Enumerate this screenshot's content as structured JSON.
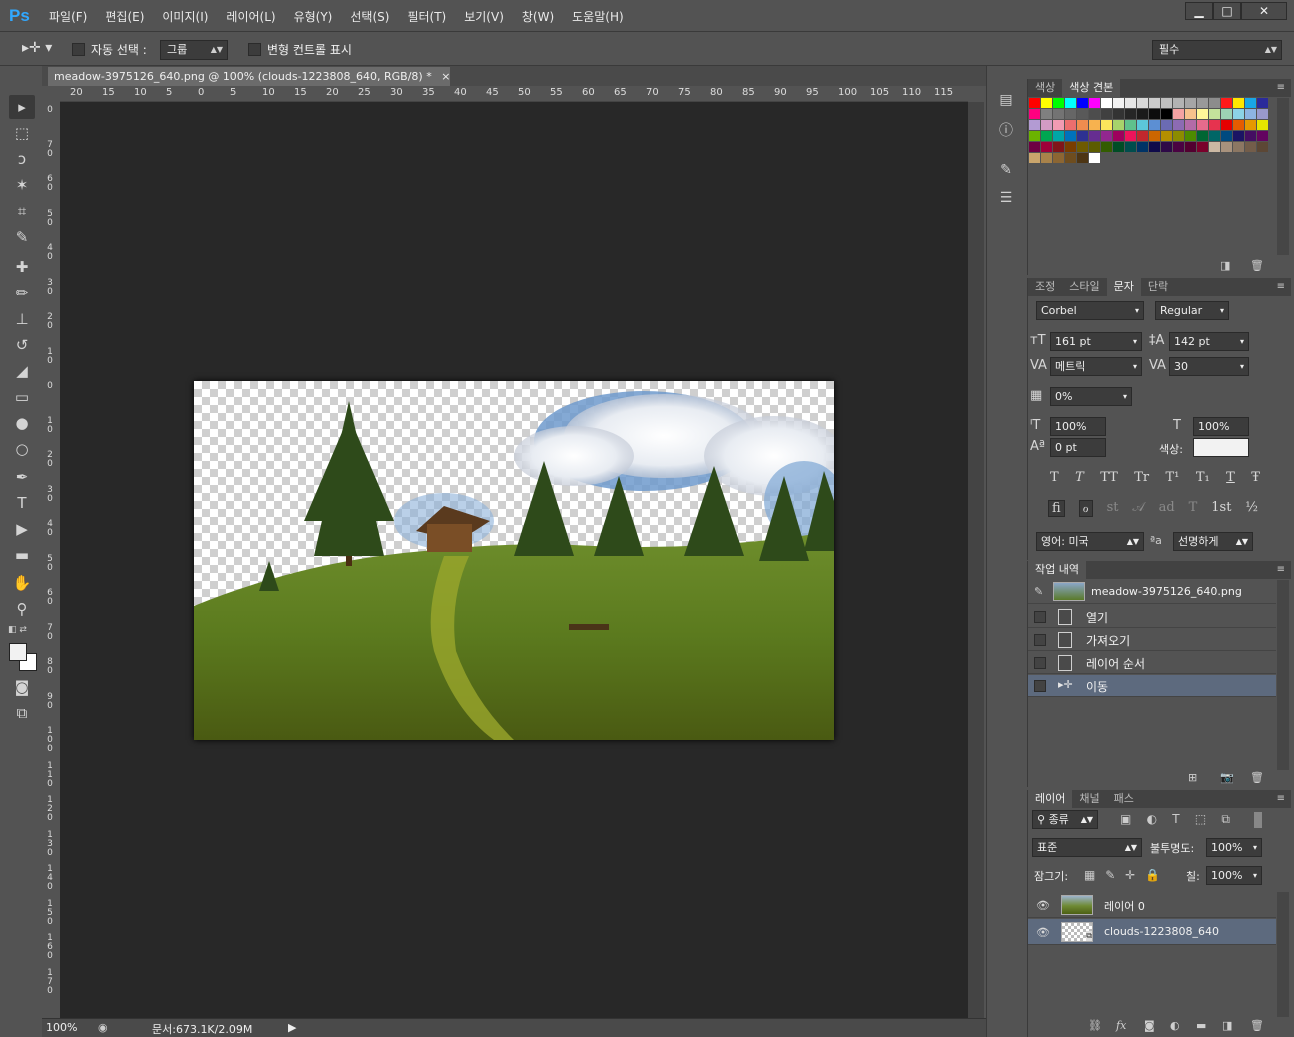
{
  "app": {
    "logo": "Ps"
  },
  "menu": [
    "파일(F)",
    "편집(E)",
    "이미지(I)",
    "레이어(L)",
    "유형(Y)",
    "선택(S)",
    "필터(T)",
    "보기(V)",
    "창(W)",
    "도움말(H)"
  ],
  "window_controls": {
    "minimize": "▁",
    "maximize": "□",
    "close": "✕"
  },
  "options": {
    "auto_select_label": "자동 선택 :",
    "auto_select_value": "그룹",
    "transform_label": "변형 컨트롤 표시",
    "workspace": "필수"
  },
  "document": {
    "tab_title": "meadow-3975126_640.png @ 100% (clouds-1223808_640, RGB/8) *",
    "tab_close": "×",
    "zoom": "100%",
    "doc_info": "문서:673.1K/2.09M"
  },
  "ruler": {
    "h": [
      "20",
      "15",
      "10",
      "5",
      "0",
      "5",
      "10",
      "15",
      "20",
      "25",
      "30",
      "35",
      "40",
      "45",
      "50",
      "55",
      "60",
      "65",
      "70",
      "75",
      "80",
      "85",
      "90",
      "95",
      "100",
      "105",
      "110",
      "115"
    ],
    "v": [
      "0",
      "70",
      "60",
      "50",
      "40",
      "30",
      "20",
      "10",
      "0",
      "10",
      "20",
      "30",
      "40",
      "50",
      "60",
      "70",
      "80",
      "90",
      "100",
      "110",
      "120",
      "130",
      "140",
      "150",
      "160",
      "170"
    ]
  },
  "swatches_panel": {
    "tabs": [
      "색상",
      "색상 견본"
    ],
    "colors": [
      "#ff0000",
      "#ffff00",
      "#00ff00",
      "#00ffff",
      "#0000ff",
      "#ff00ff",
      "#ffffff",
      "#f2f2f2",
      "#e6e6e6",
      "#d9d9d9",
      "#cccccc",
      "#bfbfbf",
      "#b3b3b3",
      "#a6a6a6",
      "#999999",
      "#8c8c8c",
      "#ff1a1a",
      "#ffe600",
      "#19a7e6",
      "#2b2b9a",
      "#ff0080",
      "#808080",
      "#737373",
      "#666666",
      "#595959",
      "#4d4d4d",
      "#404040",
      "#333333",
      "#262626",
      "#1a1a1a",
      "#0d0d0d",
      "#000000",
      "#f5a3a3",
      "#f7c28c",
      "#fff799",
      "#c4e39b",
      "#9cd3b3",
      "#8cd3e6",
      "#8db4e2",
      "#9999cc",
      "#b39bd3",
      "#d39bc4",
      "#f19bb3",
      "#ec6e6e",
      "#f08c4f",
      "#f7b24f",
      "#fbe55c",
      "#a7d36b",
      "#5fc18c",
      "#5cc7d9",
      "#5c8fd3",
      "#6b6bb3",
      "#8c6bb3",
      "#b36ba7",
      "#e66b8c",
      "#e6334f",
      "#e60000",
      "#e65c00",
      "#e69900",
      "#e6e600",
      "#6bb300",
      "#00a651",
      "#00a6a6",
      "#0072bc",
      "#2e3192",
      "#662d91",
      "#92278f",
      "#9e005d",
      "#ed145b",
      "#c1272d",
      "#cc6600",
      "#b38f00",
      "#8c8c00",
      "#4d8c00",
      "#006633",
      "#006666",
      "#004a80",
      "#1b1464",
      "#440e62",
      "#630460",
      "#6e0043",
      "#9e0039",
      "#80151a",
      "#7a3d00",
      "#6e5a00",
      "#5c5c00",
      "#335c00",
      "#004d26",
      "#004d4d",
      "#003366",
      "#0f0a4a",
      "#2e0947",
      "#4a0342",
      "#520030",
      "#7a002b",
      "#cbb8a3",
      "#a8927d",
      "#8c7763",
      "#735d4a",
      "#5c4735",
      "#c9a56c",
      "#a8824a",
      "#8c6633",
      "#6e4d1f",
      "#4d3514",
      "#ffffff"
    ]
  },
  "character_panel": {
    "tabs": [
      "조정",
      "스타일",
      "문자",
      "단락"
    ],
    "font_family": "Corbel",
    "font_style": "Regular",
    "font_size": "161 pt",
    "leading": "142 pt",
    "kerning": "메트릭",
    "tracking": "30",
    "scale_percent": "0%",
    "vertical_scale": "100%",
    "horizontal_scale": "100%",
    "baseline_shift": "0 pt",
    "color_label": "색상:",
    "text_color": "#f2f2f2",
    "style_buttons": [
      "T",
      "T",
      "TT",
      "Tr",
      "T¹",
      "T₁",
      "T",
      "Ŧ"
    ],
    "opentype_buttons": [
      "fi",
      "ℴ",
      "st",
      "𝒜",
      "ad",
      "T",
      "1st",
      "½"
    ],
    "language": "영어: 미국",
    "aa_label": "ªa",
    "antialias": "선명하게"
  },
  "history_panel": {
    "tabs": [
      "작업 내역"
    ],
    "snapshot": "meadow-3975126_640.png",
    "items": [
      "열기",
      "가져오기",
      "레이어 순서",
      "이동"
    ]
  },
  "layers_panel": {
    "tabs": [
      "레이어",
      "채널",
      "패스"
    ],
    "filter_kind": "종류",
    "blend_mode": "표준",
    "opacity_label": "불투명도:",
    "opacity": "100%",
    "lock_label": "잠그기:",
    "fill_label": "칠:",
    "fill": "100%",
    "layers": [
      {
        "name": "레이어 0",
        "visible": true,
        "selected": false
      },
      {
        "name": "clouds-1223808_640",
        "visible": true,
        "selected": true
      }
    ]
  }
}
